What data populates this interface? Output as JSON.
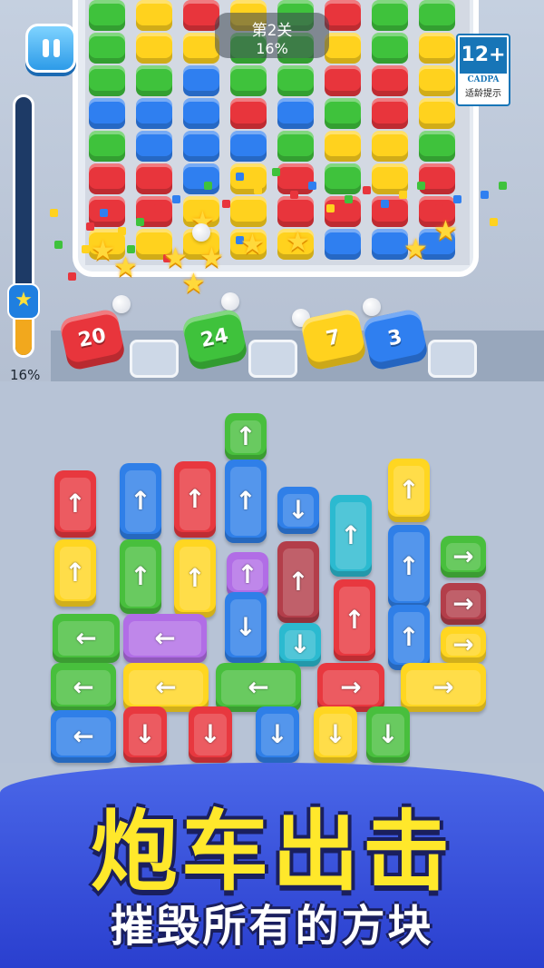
{
  "hud": {
    "level_title": "第2关",
    "level_progress": "16%",
    "side_progress_label": "16%",
    "progress_fraction": 0.16,
    "pause_icon": "pause-icon"
  },
  "age_rating": {
    "rating": "12+",
    "org": "CADPA",
    "label": "适龄提示"
  },
  "shooters": [
    {
      "count": "20",
      "color": "red"
    },
    {
      "count": "24",
      "color": "green"
    },
    {
      "count": "7",
      "color": "yellow"
    },
    {
      "count": "3",
      "color": "blue"
    }
  ],
  "empty_slots": 5,
  "colors": {
    "red": "#e8353c",
    "green": "#3fc23c",
    "blue": "#2f7ff0",
    "yellow": "#ffd21e",
    "purple": "#b16de6",
    "teal": "#2bbad0",
    "maroon": "#b33e4a",
    "banner_blue": "#3350dc",
    "title_yellow": "#ffe82b"
  },
  "banner": {
    "title": "炮车出击",
    "subtitle": "摧毁所有的方块"
  }
}
